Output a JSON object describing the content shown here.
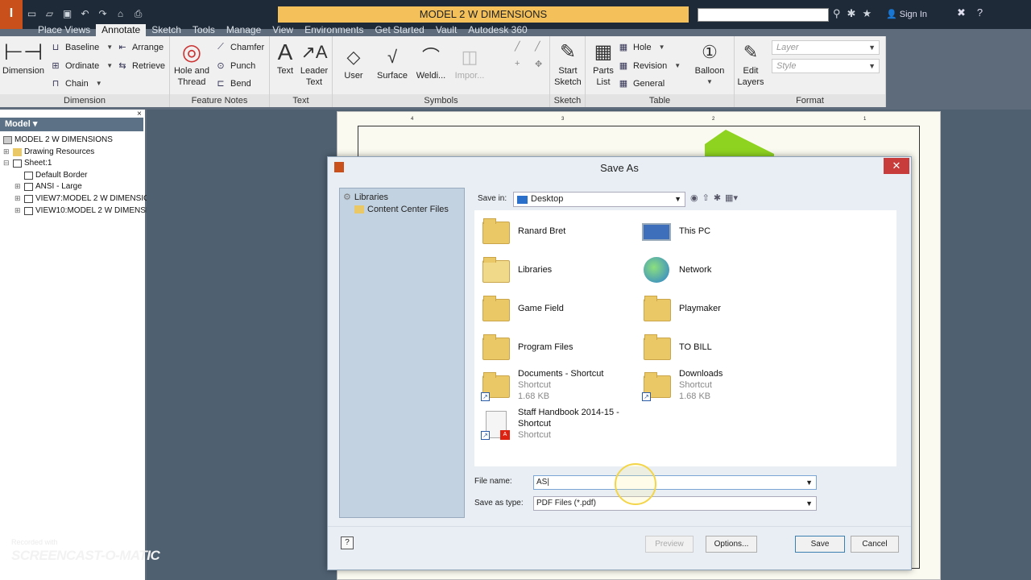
{
  "app": {
    "menu_icon": "I",
    "title": "MODEL 2 W DIMENSIONS",
    "sign_in": "Sign In",
    "qat_icons": [
      "new-icon",
      "open-icon",
      "save-icon",
      "undo-icon",
      "redo-icon",
      "home-icon",
      "print-icon"
    ],
    "colors": {
      "title_bg": "#1e2a38",
      "doc_title_bg": "#f3c05a",
      "accent": "#c9501a"
    }
  },
  "tabs": [
    "Place Views",
    "Annotate",
    "Sketch",
    "Tools",
    "Manage",
    "View",
    "Environments",
    "Get Started",
    "Vault",
    "Autodesk 360"
  ],
  "active_tab": "Annotate",
  "ribbon": {
    "dimension": {
      "label": "Dimension",
      "big": "Dimension",
      "baseline": "Baseline",
      "ordinate": "Ordinate",
      "chain": "Chain",
      "arrange": "Arrange",
      "retrieve": "Retrieve"
    },
    "feature_notes": {
      "label": "Feature Notes",
      "hole_thread_1": "Hole and",
      "hole_thread_2": "Thread",
      "chamfer": "Chamfer",
      "punch": "Punch",
      "bend": "Bend"
    },
    "text": {
      "label": "Text",
      "text": "Text",
      "leader_1": "Leader",
      "leader_2": "Text"
    },
    "symbols": {
      "label": "Symbols",
      "user": "User",
      "surface": "Surface",
      "welding": "Weldi...",
      "import": "Impor..."
    },
    "sketch": {
      "label": "Sketch",
      "start_1": "Start",
      "start_2": "Sketch"
    },
    "table": {
      "label": "Table",
      "parts_1": "Parts",
      "parts_2": "List",
      "hole": "Hole",
      "revision": "Revision",
      "general": "General"
    },
    "balloon": {
      "label": "Balloon"
    },
    "format": {
      "label": "Format",
      "edit_1": "Edit",
      "edit_2": "Layers",
      "layer": "Layer",
      "style": "Style"
    }
  },
  "browser": {
    "title": "Model",
    "items": [
      "MODEL 2 W DIMENSIONS",
      "Drawing Resources",
      "Sheet:1",
      "Default Border",
      "ANSI - Large",
      "VIEW7:MODEL 2 W DIMENSION",
      "VIEW10:MODEL 2 W DIMENSIO"
    ]
  },
  "sheet_ruler": [
    "4",
    "3",
    "2",
    "1"
  ],
  "dialog": {
    "title": "Save As",
    "libraries": "Libraries",
    "content_center": "Content Center Files",
    "save_in_label": "Save in:",
    "save_in_value": "Desktop",
    "file_name_label": "File name:",
    "file_name_value": "AS",
    "save_type_label": "Save as type:",
    "save_type_value": "PDF Files (*.pdf)",
    "buttons": {
      "preview": "Preview",
      "options": "Options...",
      "save": "Save",
      "cancel": "Cancel"
    },
    "help": "?",
    "files": [
      {
        "name": "Ranard Bret",
        "sub": "",
        "size": ""
      },
      {
        "name": "This PC",
        "sub": "",
        "size": ""
      },
      {
        "name": "Libraries",
        "sub": "",
        "size": ""
      },
      {
        "name": "Network",
        "sub": "",
        "size": ""
      },
      {
        "name": "Game Field",
        "sub": "",
        "size": ""
      },
      {
        "name": "Playmaker",
        "sub": "",
        "size": ""
      },
      {
        "name": "Program Files",
        "sub": "",
        "size": ""
      },
      {
        "name": "TO BILL",
        "sub": "",
        "size": ""
      },
      {
        "name": "Documents - Shortcut",
        "sub": "Shortcut",
        "size": "1.68 KB"
      },
      {
        "name": "Downloads",
        "sub": "Shortcut",
        "size": "1.68 KB"
      },
      {
        "name": "Staff Handbook 2014-15 -",
        "name2": "Shortcut",
        "sub": "Shortcut",
        "size": ""
      }
    ]
  },
  "watermark": {
    "line1": "Recorded with",
    "line2": "SCREENCAST-O-MATIC"
  }
}
